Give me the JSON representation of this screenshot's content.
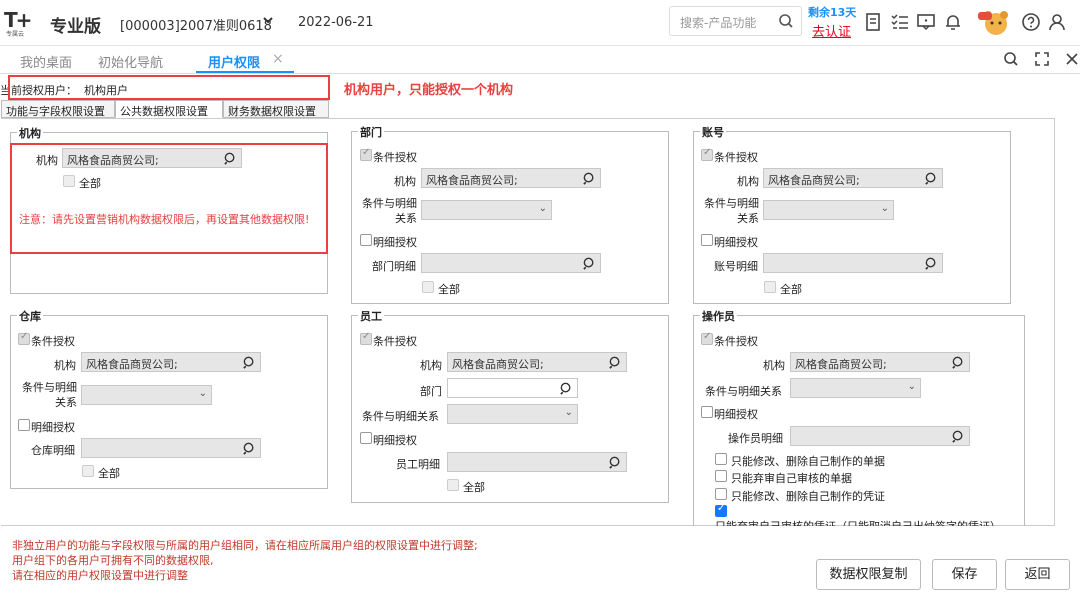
{
  "header": {
    "logo_text": "T+",
    "logo_sub": "专属云",
    "edition": "专业版",
    "account": "[000003]2007准则0618",
    "date": "2022-06-21",
    "search_placeholder": "搜索-产品功能",
    "trial_days": "剩余13天",
    "certify": "去认证"
  },
  "tabs": [
    {
      "label": "我的桌面"
    },
    {
      "label": "初始化导航"
    },
    {
      "label": "用户权限"
    }
  ],
  "current_user": {
    "label": "当前授权用户：",
    "value": "机构用户"
  },
  "annotation": "机构用户，只能授权一个机构",
  "subtabs": [
    "功能与字段权限设置",
    "公共数据权限设置",
    "财务数据权限设置"
  ],
  "org_group": {
    "title": "机构",
    "org_label": "机构",
    "org_value": "风格食品商贸公司;",
    "all_label": "全部",
    "notice": "注意：请先设置营销机构数据权限后，再设置其他数据权限!"
  },
  "dept_group": {
    "title": "部门",
    "cond_auth": "条件授权",
    "org_label": "机构",
    "org_value": "风格食品商贸公司;",
    "rel_label": "条件与明细关系",
    "detail_auth": "明细授权",
    "detail_label": "部门明细",
    "all_label": "全部"
  },
  "account_group": {
    "title": "账号",
    "cond_auth": "条件授权",
    "org_label": "机构",
    "org_value": "风格食品商贸公司;",
    "rel_label": "条件与明细关系",
    "detail_auth": "明细授权",
    "detail_label": "账号明细",
    "all_label": "全部"
  },
  "warehouse_group": {
    "title": "仓库",
    "cond_auth": "条件授权",
    "org_label": "机构",
    "org_value": "风格食品商贸公司;",
    "rel_label": "条件与明细关系",
    "detail_auth": "明细授权",
    "detail_label": "仓库明细",
    "all_label": "全部"
  },
  "employee_group": {
    "title": "员工",
    "cond_auth": "条件授权",
    "org_label": "机构",
    "org_value": "风格食品商贸公司;",
    "dept_label": "部门",
    "rel_label": "条件与明细关系",
    "detail_auth": "明细授权",
    "detail_label": "员工明细",
    "all_label": "全部"
  },
  "operator_group": {
    "title": "操作员",
    "cond_auth": "条件授权",
    "org_label": "机构",
    "org_value": "风格食品商贸公司;",
    "rel_label": "条件与明细关系",
    "detail_auth": "明细授权",
    "detail_label": "操作员明细",
    "opt1": "只能修改、删除自己制作的单据",
    "opt2": "只能弃审自己审核的单据",
    "opt3": "只能修改、删除自己制作的凭证",
    "opt4": "只能弃审自己审核的凭证（只能取消自己出纳签字的凭证）"
  },
  "footer_notes": [
    "非独立用户的功能与字段权限与所属的用户组相同，请在相应所属用户组的权限设置中进行调整;",
    "用户组下的各用户可拥有不同的数据权限,",
    "请在相应的用户权限设置中进行调整"
  ],
  "buttons": {
    "copy": "数据权限复制",
    "save": "保存",
    "back": "返回"
  }
}
